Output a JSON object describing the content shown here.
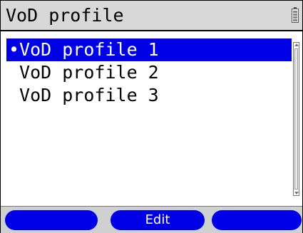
{
  "header": {
    "title": "VoD profile",
    "status_icon": "battery-icon"
  },
  "profiles": {
    "items": [
      {
        "label": "•VoD profile 1",
        "selected": true
      },
      {
        "label": " VoD profile 2",
        "selected": false
      },
      {
        "label": " VoD profile 3",
        "selected": false
      }
    ]
  },
  "softkeys": {
    "left": "",
    "middle": "Edit",
    "right": ""
  },
  "colors": {
    "selection": "#0000e6",
    "softkey": "#0000e6",
    "titlebar": "#d8d8d8"
  }
}
